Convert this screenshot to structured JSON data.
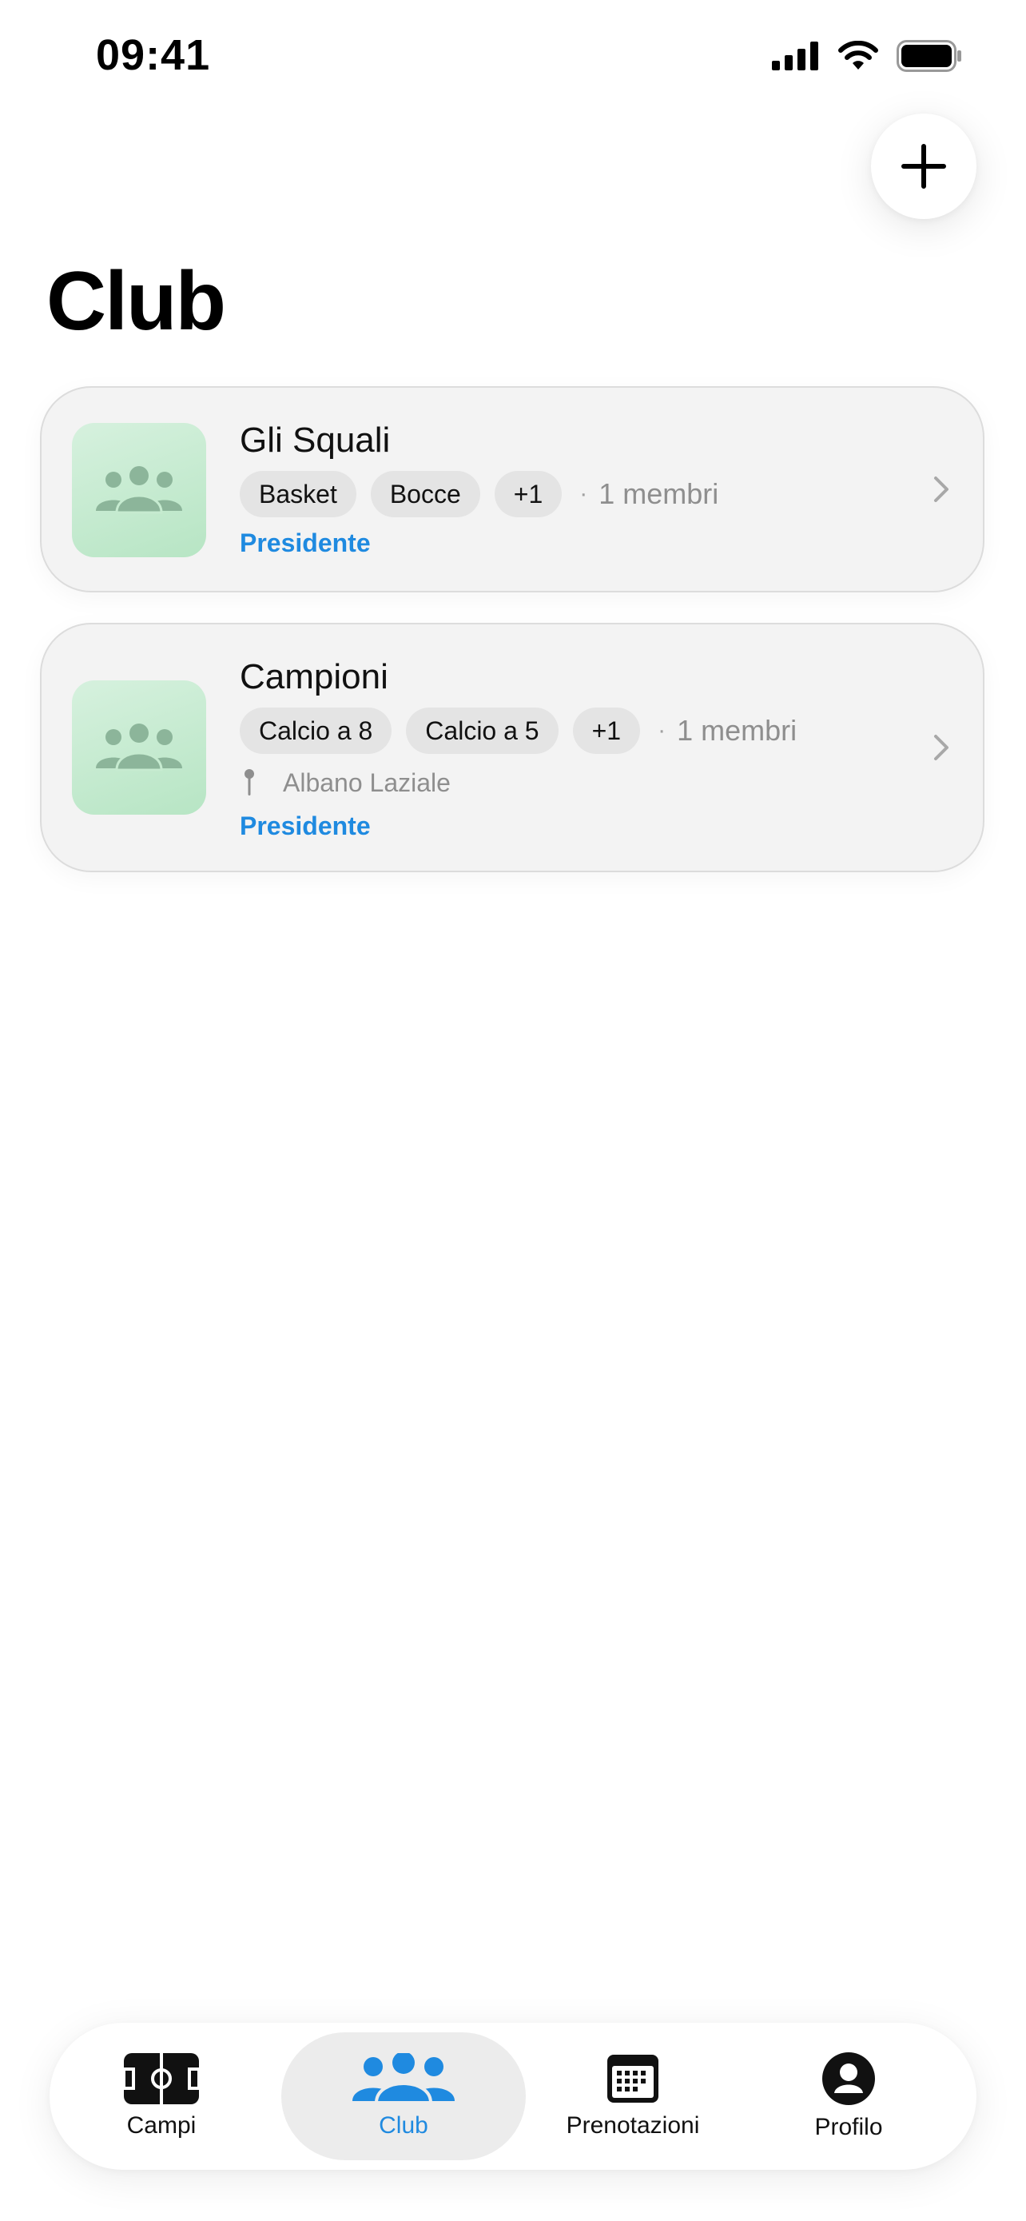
{
  "status_bar": {
    "time": "09:41"
  },
  "header": {
    "title": "Club"
  },
  "clubs": [
    {
      "name": "Gli Squali",
      "tags": [
        "Basket",
        "Bocce",
        "+1"
      ],
      "separator": "·",
      "members": "1 membri",
      "location": "",
      "role": "Presidente"
    },
    {
      "name": "Campioni",
      "tags": [
        "Calcio a 8",
        "Calcio a 5",
        "+1"
      ],
      "separator": "·",
      "members": "1 membri",
      "location": "Albano Laziale",
      "role": "Presidente"
    }
  ],
  "tabbar": {
    "active": "club",
    "items": [
      {
        "id": "campi",
        "label": "Campi",
        "icon": "football-field-icon"
      },
      {
        "id": "club",
        "label": "Club",
        "icon": "people-icon"
      },
      {
        "id": "prenotazioni",
        "label": "Prenotazioni",
        "icon": "calendar-icon"
      },
      {
        "id": "profilo",
        "label": "Profilo",
        "icon": "person-circle-icon"
      }
    ]
  },
  "colors": {
    "accent": "#1f8ae0",
    "card_bg": "#f3f3f3",
    "tag_bg": "#e4e4e4",
    "thumb_green": "#c6ebd0",
    "muted_text": "#8e8e8e"
  }
}
